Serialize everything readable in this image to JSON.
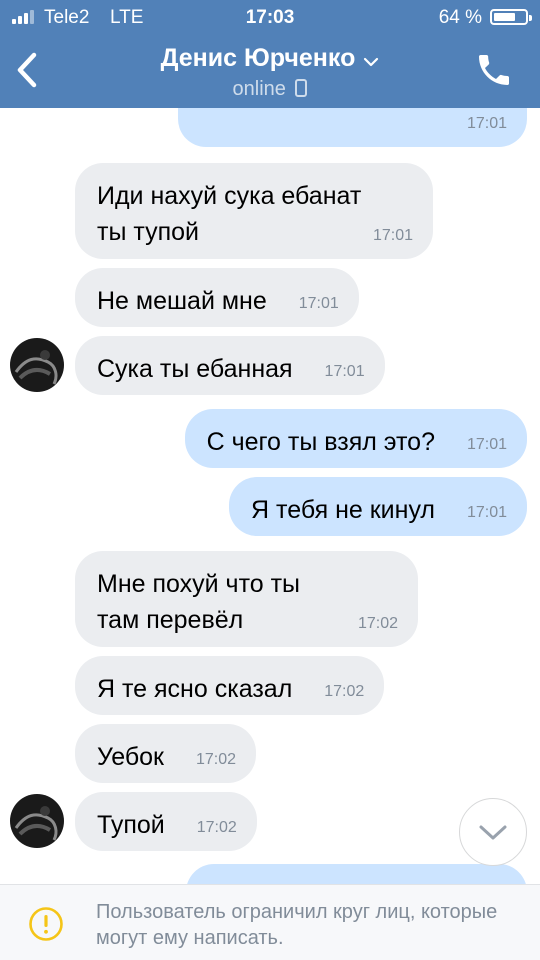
{
  "status_bar": {
    "carrier": "Tele2",
    "network": "LTE",
    "time": "17:03",
    "battery": "64 %",
    "battery_level": 0.64
  },
  "header": {
    "contact_name": "Денис Юрченко",
    "presence": "online",
    "icons": {
      "back": "chevron-left-icon",
      "dropdown": "chevron-down-icon",
      "device": "mobile-phone-icon",
      "call": "phone-icon"
    }
  },
  "messages": [
    {
      "direction": "out",
      "text": "",
      "time": "17:01"
    },
    {
      "direction": "in",
      "text": "Иди нахуй сука ебанат ты тупой",
      "time": "17:01"
    },
    {
      "direction": "in",
      "text": "Не мешай мне",
      "time": "17:01"
    },
    {
      "direction": "in",
      "text": "Сука ты ебанная",
      "time": "17:01"
    },
    {
      "direction": "out",
      "text": "С чего ты взял это?",
      "time": "17:01"
    },
    {
      "direction": "out",
      "text": "Я тебя не кинул",
      "time": "17:01"
    },
    {
      "direction": "in",
      "text": "Мне похуй что ты там перевёл",
      "time": "17:02"
    },
    {
      "direction": "in",
      "text": "Я те ясно сказал",
      "time": "17:02"
    },
    {
      "direction": "in",
      "text": "Уебок",
      "time": "17:02"
    },
    {
      "direction": "in",
      "text": "Тупой",
      "time": "17:02"
    },
    {
      "direction": "out",
      "text": "",
      "time": ""
    }
  ],
  "scroll_down_icon": "chevron-down-icon",
  "footer": {
    "icon": "warning-icon",
    "notice": "Пользователь ограничил круг лиц, которые могут ему написать."
  },
  "colors": {
    "header": "#5181b8",
    "incoming_bubble": "#ebedf0",
    "outgoing_bubble": "#cce4ff",
    "timestamp": "#818c99",
    "warning": "#f5c518"
  }
}
